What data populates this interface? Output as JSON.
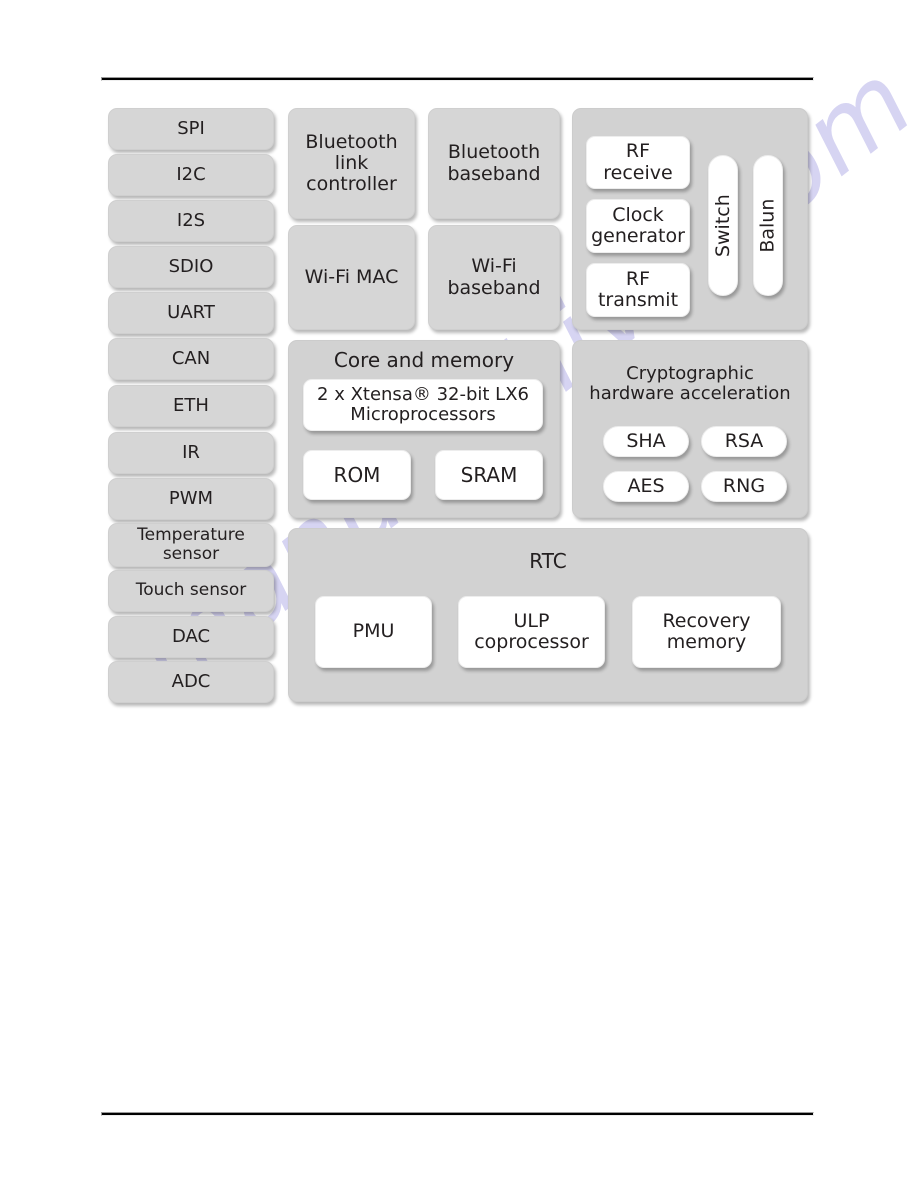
{
  "document": {
    "type": "block-diagram",
    "subject": "ESP32 functional block diagram",
    "watermark": "manualshive.com",
    "watermark_color": "#c9c6ee",
    "colors": {
      "node_gray": "#d6d6d6",
      "panel_gray": "#d2d2d2",
      "node_white": "#ffffff",
      "text": "#231f20",
      "rule": "#000000",
      "page_background": "#ffffff"
    }
  },
  "peripherals": {
    "items": [
      {
        "label": "SPI"
      },
      {
        "label": "I2C"
      },
      {
        "label": "I2S"
      },
      {
        "label": "SDIO"
      },
      {
        "label": "UART"
      },
      {
        "label": "CAN"
      },
      {
        "label": "ETH"
      },
      {
        "label": "IR"
      },
      {
        "label": "PWM"
      },
      {
        "label": "Temperature sensor"
      },
      {
        "label": "Touch sensor"
      },
      {
        "label": "DAC"
      },
      {
        "label": "ADC"
      }
    ]
  },
  "radio": {
    "blocks": [
      {
        "label": "Bluetooth link controller"
      },
      {
        "label": "Bluetooth baseband"
      },
      {
        "label": "Wi-Fi MAC"
      },
      {
        "label": "Wi-Fi baseband"
      }
    ]
  },
  "rf": {
    "title": "",
    "blocks": [
      {
        "label": "RF receive"
      },
      {
        "label": "Clock generator"
      },
      {
        "label": "RF transmit"
      }
    ],
    "vertical_blocks": [
      {
        "label": "Switch"
      },
      {
        "label": "Balun"
      }
    ]
  },
  "core_and_memory": {
    "title": "Core and memory",
    "processor": "2 x Xtensa® 32-bit LX6 Microprocessors",
    "memories": [
      {
        "label": "ROM"
      },
      {
        "label": "SRAM"
      }
    ]
  },
  "crypto": {
    "title": "Cryptographic hardware acceleration",
    "engines": [
      {
        "label": "SHA"
      },
      {
        "label": "RSA"
      },
      {
        "label": "AES"
      },
      {
        "label": "RNG"
      }
    ]
  },
  "rtc": {
    "title": "RTC",
    "blocks": [
      {
        "label": "PMU"
      },
      {
        "label": "ULP coprocessor"
      },
      {
        "label": "Recovery memory"
      }
    ]
  }
}
